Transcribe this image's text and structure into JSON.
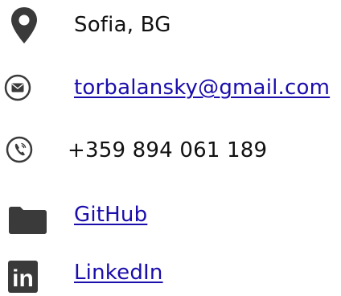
{
  "contacts": {
    "location": {
      "icon": "map-pin-icon",
      "text": "Sofia, BG"
    },
    "email": {
      "icon": "envelope-icon",
      "text": "torbalansky@gmail.com"
    },
    "phone": {
      "icon": "phone-icon",
      "text": "+359 894 061 189"
    },
    "github": {
      "icon": "folder-icon",
      "text": "GitHub"
    },
    "linkedin": {
      "icon": "linkedin-icon",
      "text": "LinkedIn",
      "icon_text": "in"
    }
  },
  "colors": {
    "icon": "#3a3a3a",
    "link": "#1a0dab",
    "text": "#111111",
    "background": "#ffffff"
  }
}
